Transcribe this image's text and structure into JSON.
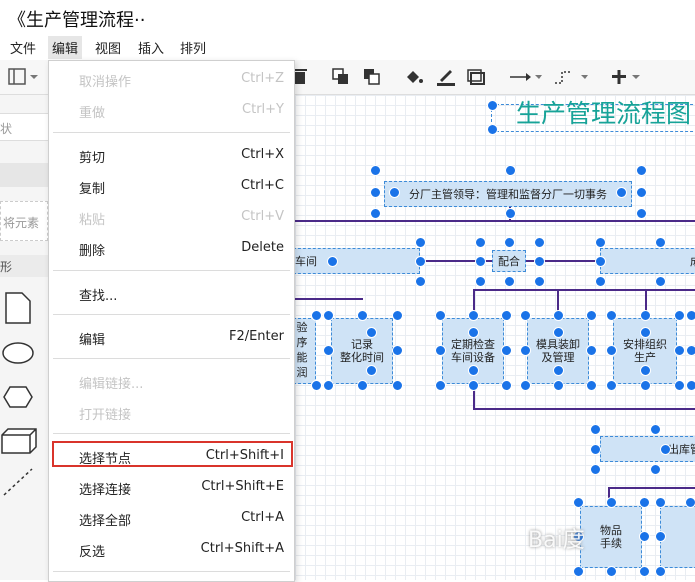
{
  "window": {
    "title": "《生产管理流程··"
  },
  "menubar": {
    "items": [
      "文件",
      "编辑",
      "视图",
      "插入",
      "排列"
    ]
  },
  "sidebar": {
    "labels": [
      "状",
      "将元素",
      "形"
    ]
  },
  "diagram": {
    "title": "生产管理流程图",
    "nodes": {
      "top": "分厂主管领导：管理和监督分厂一切事务",
      "left_mid": "车间",
      "coordinate": "配合",
      "right_mid": "成",
      "left_col_lines": [
        "验",
        "序",
        "能",
        "润"
      ],
      "record": "记录\n整化时间",
      "inspect": "定期检查\n车间设备",
      "mold": "模具装卸\n及管理",
      "arrange": "安排组织\n生产",
      "outbound": "出库管",
      "bottom_a": "物品\n手续"
    }
  },
  "edit_menu": {
    "items": [
      {
        "label": "取消操作",
        "shortcut": "Ctrl+Z",
        "disabled": true
      },
      {
        "label": "重做",
        "shortcut": "Ctrl+Y",
        "disabled": true
      },
      {
        "label": "剪切",
        "shortcut": "Ctrl+X",
        "disabled": false
      },
      {
        "label": "复制",
        "shortcut": "Ctrl+C",
        "disabled": false
      },
      {
        "label": "粘贴",
        "shortcut": "Ctrl+V",
        "disabled": true
      },
      {
        "label": "删除",
        "shortcut": "Delete",
        "disabled": false
      },
      {
        "label": "查找...",
        "shortcut": "",
        "disabled": false
      },
      {
        "label": "编辑",
        "shortcut": "F2/Enter",
        "disabled": false
      },
      {
        "label": "编辑链接...",
        "shortcut": "",
        "disabled": true
      },
      {
        "label": "打开链接",
        "shortcut": "",
        "disabled": true
      },
      {
        "label": "选择节点",
        "shortcut": "Ctrl+Shift+I",
        "disabled": false,
        "highlighted": true
      },
      {
        "label": "选择连接",
        "shortcut": "Ctrl+Shift+E",
        "disabled": false
      },
      {
        "label": "选择全部",
        "shortcut": "Ctrl+A",
        "disabled": false
      },
      {
        "label": "反选",
        "shortcut": "Ctrl+Shift+A",
        "disabled": false
      }
    ]
  },
  "watermark": "Bai度",
  "colors": {
    "accent_title": "#17a398",
    "node_fill": "#cfe3f6",
    "handle": "#1a73e8",
    "edge": "#4b2a88",
    "highlight_box": "#d9342b"
  }
}
